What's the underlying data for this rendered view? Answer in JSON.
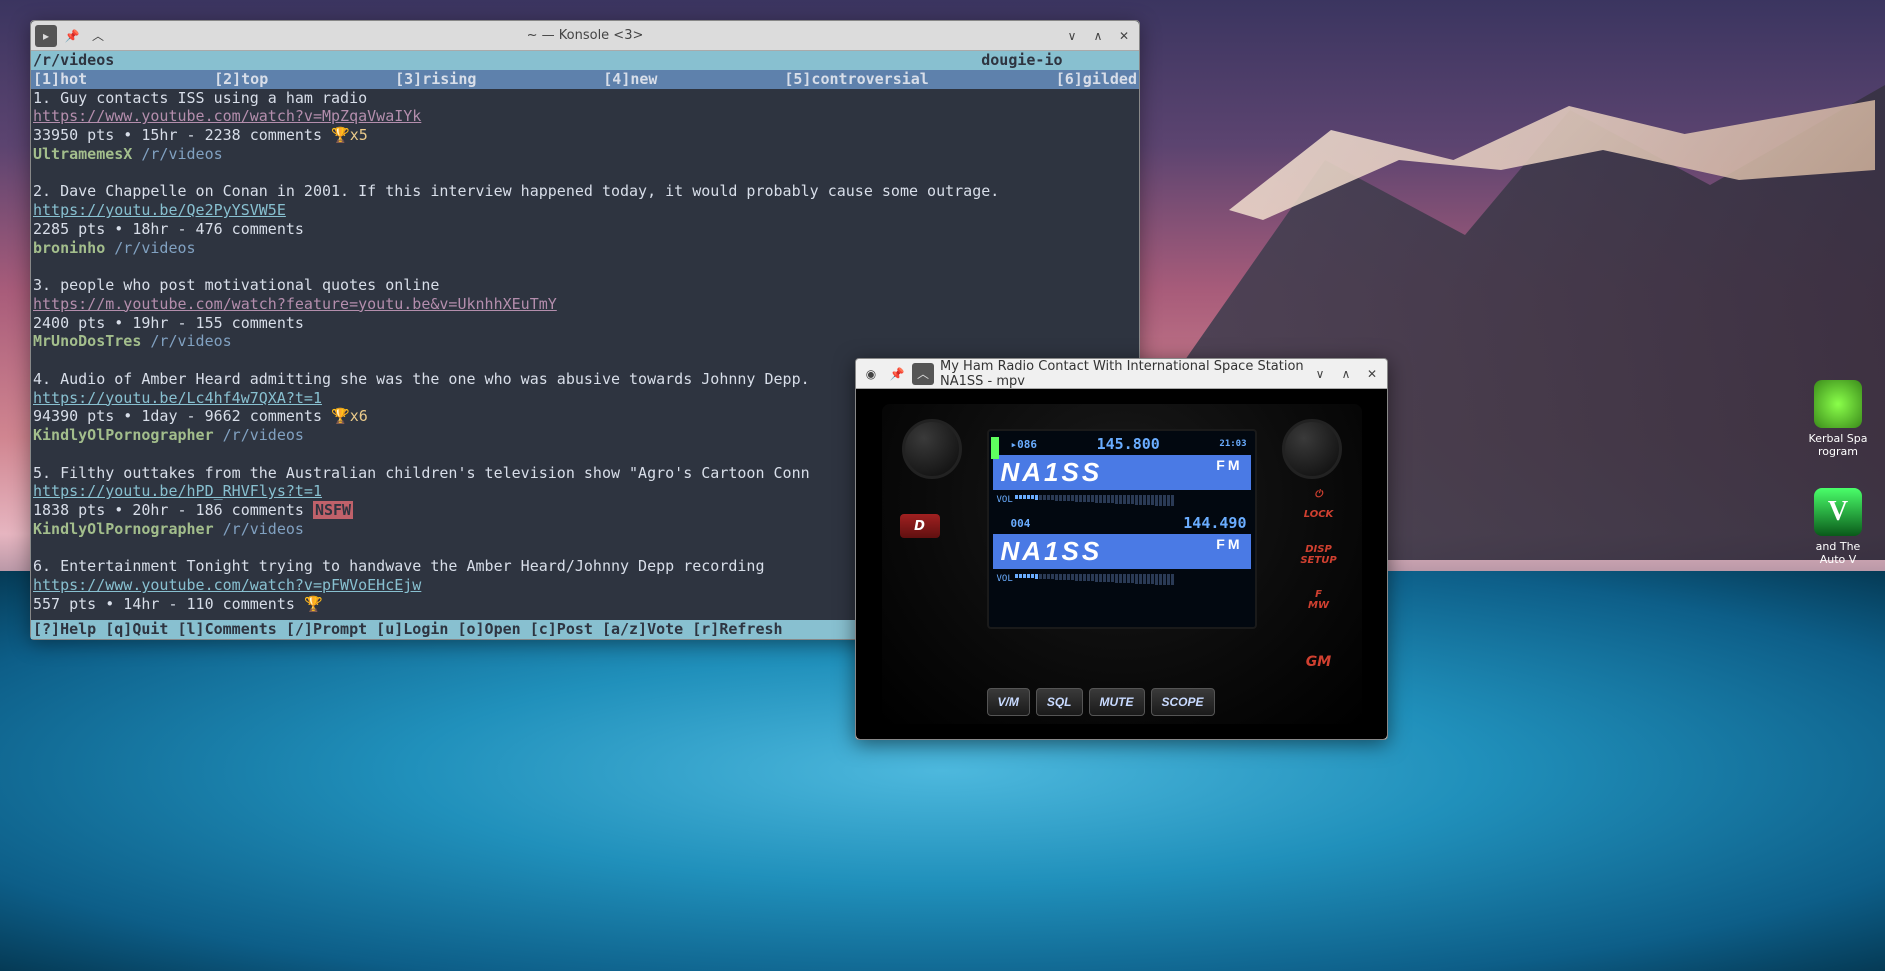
{
  "konsole": {
    "title": "~ — Konsole <3>",
    "header": {
      "path": "/r/videos",
      "user": "dougie-io"
    },
    "tabs": [
      {
        "key": "[1]",
        "label": "hot"
      },
      {
        "key": "[2]",
        "label": "top"
      },
      {
        "key": "[3]",
        "label": "rising"
      },
      {
        "key": "[4]",
        "label": "new"
      },
      {
        "key": "[5]",
        "label": "controversial"
      },
      {
        "key": "[6]",
        "label": "gilded"
      }
    ],
    "posts": [
      {
        "num": "1.",
        "title": "Guy contacts ISS using a ham radio",
        "url": "https://www.youtube.com/watch?v=MpZqaVwaIYk",
        "visited": true,
        "meta": "33950 pts • 15hr - 2238 comments ",
        "gilded": "🏆x5",
        "author": "UltramemesX",
        "sub": "/r/videos"
      },
      {
        "num": "2.",
        "title": "Dave Chappelle on Conan in 2001. If this interview happened today, it would probably cause some outrage.",
        "url": "https://youtu.be/Qe2PyYSVW5E",
        "visited": false,
        "meta": "2285 pts • 18hr - 476 comments",
        "author": "broninho",
        "sub": "/r/videos"
      },
      {
        "num": "3.",
        "title": "people who post motivational quotes online",
        "url": "https://m.youtube.com/watch?feature=youtu.be&v=UknhhXEuTmY",
        "visited": true,
        "meta": "2400 pts • 19hr - 155 comments",
        "author": "MrUnoDosTres",
        "sub": "/r/videos"
      },
      {
        "num": "4.",
        "title": "Audio of Amber Heard admitting she was the one who was abusive towards Johnny Depp.",
        "url": "https://youtu.be/Lc4hf4w7QXA?t=1",
        "visited": false,
        "meta": "94390 pts • 1day - 9662 comments ",
        "gilded": "🏆x6",
        "author": "KindlyOlPornographer",
        "sub": "/r/videos"
      },
      {
        "num": "5.",
        "title": "Filthy outtakes from the Australian children's television show \"Agro's Cartoon Conn",
        "url": "https://youtu.be/hPD_RHVFlys?t=1",
        "visited": false,
        "meta": "1838 pts • 20hr - 186 comments ",
        "nsfw": "NSFW",
        "author": "KindlyOlPornographer",
        "sub": "/r/videos"
      },
      {
        "num": "6.",
        "title": "Entertainment Tonight trying to handwave the Amber Heard/Johnny Depp recording",
        "url": "https://www.youtube.com/watch?v=pFWVoEHcEjw",
        "visited": false,
        "meta": "557 pts • 14hr - 110 comments ",
        "gilded": "🏆",
        "author": "",
        "sub": ""
      }
    ],
    "help": "[?]Help [q]Quit [l]Comments [/]Prompt [u]Login [o]Open [c]Post [a/z]Vote [r]Refresh"
  },
  "mpv": {
    "title": "My Ham Radio Contact With International Space Station NA1SS - mpv",
    "radio": {
      "time": "21:03",
      "row1": {
        "channel": "▸086",
        "freq": "145.800"
      },
      "callsign1": "NA1SS",
      "mode1": "FM",
      "row2": {
        "channel": "004",
        "freq": "144.490"
      },
      "callsign2": "NA1SS",
      "mode2": "FM",
      "vol": "VOL",
      "buttons": [
        "V/M",
        "SQL",
        "MUTE",
        "SCOPE"
      ],
      "leftbtn": "D",
      "side": {
        "power": "⏻",
        "lock": "LOCK",
        "disp": "DISP\nSETUP",
        "f": "F\nMW",
        "gm": "GM"
      }
    }
  },
  "desktop": {
    "icons": [
      {
        "label": "Kerbal Spa\nrogram",
        "class": "kerbal"
      },
      {
        "label": "and The\nAuto V",
        "class": "gtav",
        "text": "V"
      }
    ]
  }
}
